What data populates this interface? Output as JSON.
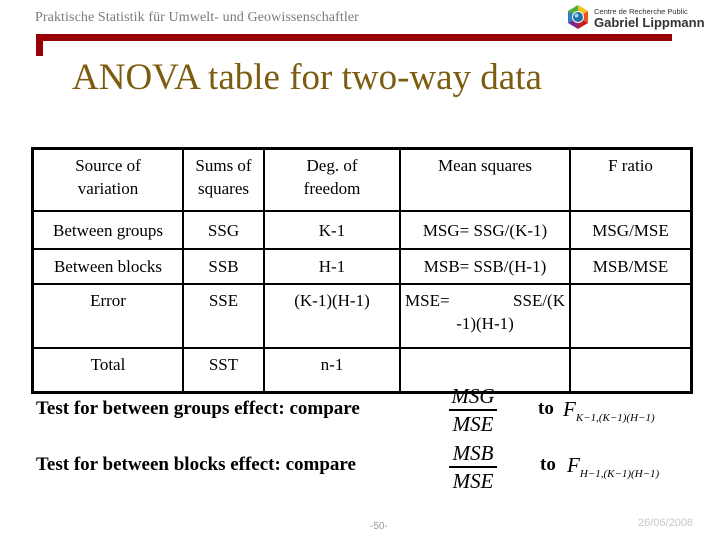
{
  "header": {
    "course_title": "Praktische Statistik für Umwelt- und Geowissenschaftler",
    "logo": {
      "icon": "hexagon-logo-icon",
      "line1": "Centre de Recherche Public",
      "line2": "Gabriel Lippmann"
    },
    "accent_color": "#970007"
  },
  "slide": {
    "title": "ANOVA table for two-way data",
    "title_color": "#7c5d10"
  },
  "table": {
    "headers": [
      [
        "Source of",
        "variation"
      ],
      [
        "Sums of",
        "squares"
      ],
      [
        "Deg. of",
        "freedom"
      ],
      [
        "Mean squares"
      ],
      [
        "F ratio"
      ]
    ],
    "rows": [
      {
        "source": "Between groups",
        "ss": "SSG",
        "df": "K-1",
        "ms": "MSG= SSG/(K-1)",
        "f": "MSG/MSE"
      },
      {
        "source": "Between blocks",
        "ss": "SSB",
        "df": "H-1",
        "ms": "MSB= SSB/(H-1)",
        "f": "MSB/MSE"
      },
      {
        "source": "Error",
        "ss": "SSE",
        "df": "(K-1)(H-1)",
        "ms_line1_a": "MSE=",
        "ms_line1_b": "SSE/(K",
        "ms_line2": "-1)(H-1)",
        "f": ""
      },
      {
        "source": "Total",
        "ss": "SST",
        "df": "n-1",
        "ms": "",
        "f": ""
      }
    ]
  },
  "tests": [
    {
      "text": "Test for between groups effect: compare",
      "numerator": "MSG",
      "denominator": "MSE",
      "to": "to",
      "F": "F",
      "subscript": "K−1,(K−1)(H−1)"
    },
    {
      "text": "Test for between blocks effect: compare",
      "numerator": "MSB",
      "denominator": "MSE",
      "to": "to",
      "F": "F",
      "subscript": "H−1,(K−1)(H−1)"
    }
  ],
  "footer": {
    "page": "-50-",
    "date": "26/06/2008"
  }
}
